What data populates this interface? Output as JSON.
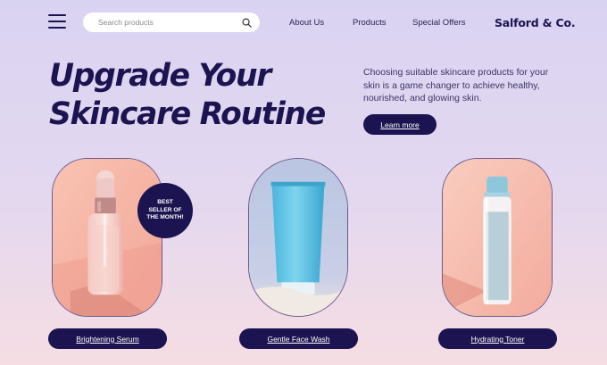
{
  "header": {
    "menu_icon": "hamburger-menu-icon",
    "search": {
      "placeholder": "Search products",
      "icon": "search-icon"
    },
    "nav": [
      {
        "label": "About Us"
      },
      {
        "label": "Products"
      },
      {
        "label": "Special Offers"
      }
    ],
    "brand": "Salford & Co."
  },
  "hero": {
    "title_line1": "Upgrade Your",
    "title_line2": "Skincare Routine",
    "description": "Choosing suitable skincare products for your skin is a game changer to achieve healthy, nourished, and glowing skin.",
    "cta_label": "Learn more"
  },
  "products": [
    {
      "name": "Brightening Serum",
      "image": "serum-dropper-bottle",
      "badge": "BEST SELLER OF THE MONTH!"
    },
    {
      "name": "Gentle Face Wash",
      "image": "blue-cleanser-tube"
    },
    {
      "name": "Hydrating Toner",
      "image": "toner-bottle"
    }
  ],
  "colors": {
    "primary": "#1b1450",
    "background_top": "#d9d3f2",
    "background_bottom": "#f6dde3",
    "card_peach": "#f5b7a8",
    "tube_blue": "#5cc4e6"
  }
}
